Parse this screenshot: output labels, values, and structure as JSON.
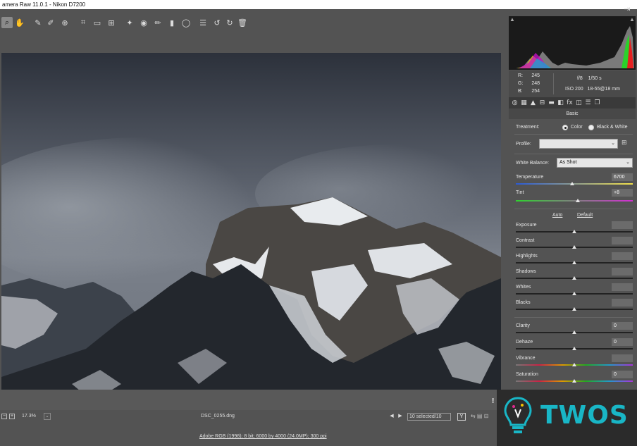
{
  "window": {
    "title": "amera Raw 11.0.1  -  Nikon D7200"
  },
  "toolbar": {
    "tools": [
      {
        "name": "zoom-tool",
        "glyph": "⌕"
      },
      {
        "name": "hand-tool",
        "glyph": "✋"
      },
      {
        "name": "white-balance-tool",
        "glyph": "✎"
      },
      {
        "name": "color-sampler-tool",
        "glyph": "✐"
      },
      {
        "name": "targeted-adjustment-tool",
        "glyph": "⊕"
      },
      {
        "name": "crop-tool",
        "glyph": "⌗"
      },
      {
        "name": "straighten-tool",
        "glyph": "▭"
      },
      {
        "name": "transform-tool",
        "glyph": "⊞"
      },
      {
        "name": "spot-removal-tool",
        "glyph": "✦"
      },
      {
        "name": "red-eye-tool",
        "glyph": "◉"
      },
      {
        "name": "adjustment-brush-tool",
        "glyph": "✏"
      },
      {
        "name": "graduated-filter-tool",
        "glyph": "▮"
      },
      {
        "name": "radial-filter-tool",
        "glyph": "◯"
      },
      {
        "name": "preferences-tool",
        "glyph": "☰"
      },
      {
        "name": "rotate-left-tool",
        "glyph": "↺"
      },
      {
        "name": "rotate-right-tool",
        "glyph": "↻"
      },
      {
        "name": "delete-tool",
        "glyph": "🗑"
      }
    ],
    "fullscreen_glyph": "⇥"
  },
  "info": {
    "r_label": "R:",
    "r_value": "245",
    "g_label": "G:",
    "g_value": "248",
    "b_label": "B:",
    "b_value": "254",
    "aperture": "f/8",
    "shutter": "1/50 s",
    "iso": "ISO 200",
    "lens": "18-55@18 mm"
  },
  "panel_tabs": [
    "◎",
    "▦",
    "▲",
    "⊟",
    "▬",
    "◧",
    "fx",
    "◫",
    "☰",
    "❐"
  ],
  "basic": {
    "header": "Basic",
    "treatment_label": "Treatment:",
    "treatment_color": "Color",
    "treatment_bw": "Black & White",
    "profile_label": "Profile:",
    "profile_value": "",
    "wb_label": "White Balance:",
    "wb_value": "As Shot",
    "temperature_label": "Temperature",
    "temperature_value": "6700",
    "temperature_pos": 0.48,
    "tint_label": "Tint",
    "tint_value": "+8",
    "tint_pos": 0.53,
    "auto_label": "Auto",
    "default_label": "Default",
    "sliders": [
      {
        "key": "exposure",
        "label": "Exposure",
        "value": "",
        "pos": 0.5
      },
      {
        "key": "contrast",
        "label": "Contrast",
        "value": "",
        "pos": 0.5
      },
      {
        "key": "highlights",
        "label": "Highlights",
        "value": "",
        "pos": 0.5
      },
      {
        "key": "shadows",
        "label": "Shadows",
        "value": "",
        "pos": 0.5
      },
      {
        "key": "whites",
        "label": "Whites",
        "value": "",
        "pos": 0.5
      },
      {
        "key": "blacks",
        "label": "Blacks",
        "value": "",
        "pos": 0.5
      }
    ],
    "presence": [
      {
        "key": "clarity",
        "label": "Clarity",
        "value": "0",
        "pos": 0.5
      },
      {
        "key": "dehaze",
        "label": "Dehaze",
        "value": "0",
        "pos": 0.5
      },
      {
        "key": "vibrance",
        "label": "Vibrance",
        "value": "",
        "pos": 0.5
      },
      {
        "key": "saturation",
        "label": "Saturation",
        "value": "0",
        "pos": 0.5
      }
    ]
  },
  "status": {
    "zoom": "17.3%",
    "filename": "DSC_0255.dng",
    "selected": "10 selected/10",
    "y_label": "Y"
  },
  "footer": {
    "workflow": "Adobe RGB (1998); 8 bit; 6000 by 4000 (24.0MP); 300 ppi"
  },
  "watermark": {
    "text": "TWOS"
  },
  "colors": {
    "accent": "#19b6c6",
    "panel": "#535353",
    "histogram_bg": "#1a1a1a"
  }
}
